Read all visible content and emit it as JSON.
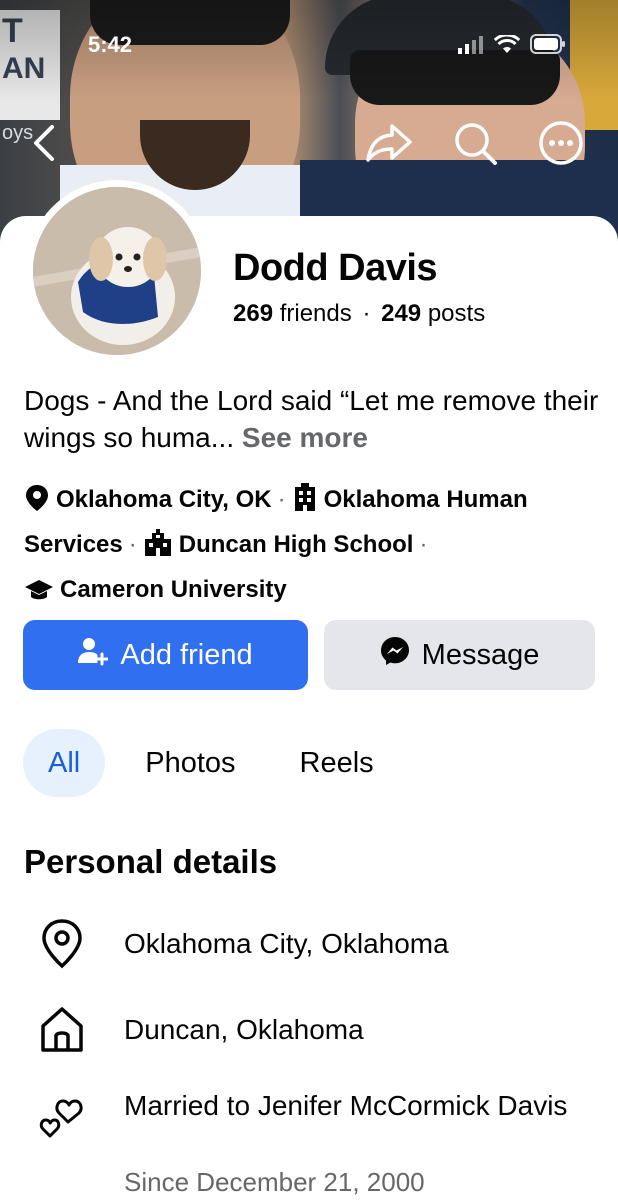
{
  "status_bar": {
    "time": "5:42"
  },
  "cover": {
    "sign_letters": [
      "T",
      "AN",
      "oys"
    ]
  },
  "header_actions": {
    "back_icon": "chevron-left-icon",
    "share_icon": "share-arrow-icon",
    "search_icon": "search-icon",
    "more_icon": "more-horizontal-icon"
  },
  "profile": {
    "name": "Dodd Davis",
    "friends_count": "269",
    "friends_label": "friends",
    "separator": "·",
    "posts_count": "249",
    "posts_label": "posts"
  },
  "bio": {
    "text": "Dogs - And the Lord said “Let me remove their wings so huma...",
    "see_more": "See more"
  },
  "intro": {
    "location": "Oklahoma City, OK",
    "work": "Oklahoma Human Services",
    "high_school": "Duncan High School",
    "college": "Cameron University"
  },
  "buttons": {
    "add_friend": "Add friend",
    "message": "Message"
  },
  "tabs": [
    {
      "label": "All",
      "active": true
    },
    {
      "label": "Photos",
      "active": false
    },
    {
      "label": "Reels",
      "active": false
    }
  ],
  "personal_details": {
    "title": "Personal details",
    "items": [
      {
        "icon": "location-pin-icon",
        "text": "Oklahoma City, Oklahoma"
      },
      {
        "icon": "home-icon",
        "text": "Duncan, Oklahoma"
      },
      {
        "icon": "hearts-icon",
        "text": "Married to Jenifer McCormick Davis",
        "sub": "Since December 21, 2000"
      }
    ]
  },
  "colors": {
    "primary_blue": "#2f6ff0",
    "secondary_button": "#e4e6eb",
    "active_tab_bg": "#e7f0fd",
    "active_tab_text": "#1b5fd6",
    "muted_text": "#65676b"
  }
}
